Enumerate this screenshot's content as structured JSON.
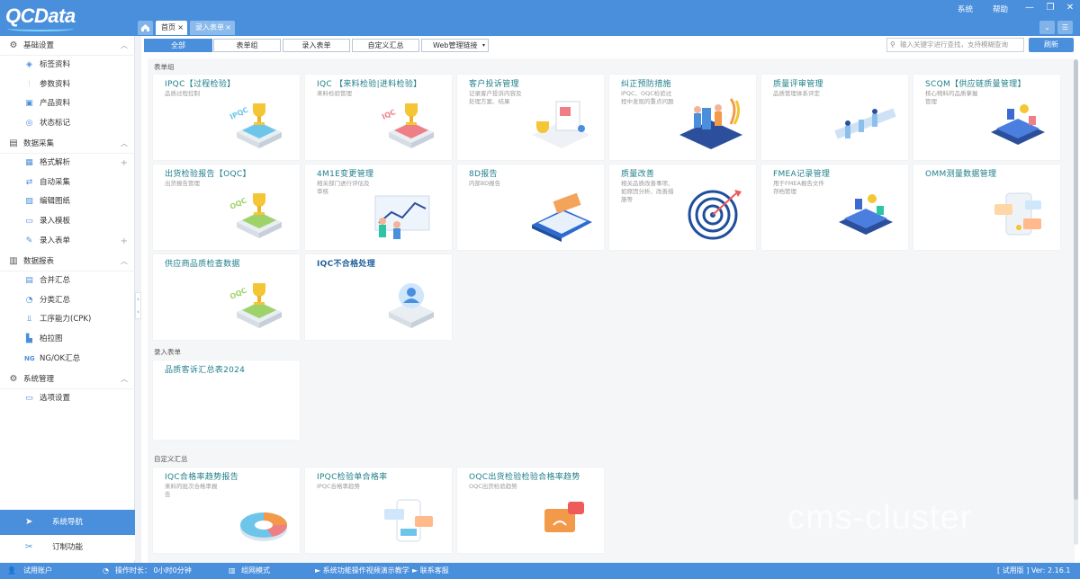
{
  "app": {
    "logo": "QCData"
  },
  "topmenu": {
    "system": "系统",
    "help": "帮助"
  },
  "window_controls": {
    "minimize": "—",
    "restore": "❐",
    "close": "✕"
  },
  "tabs": [
    {
      "label": "首页",
      "close": "×"
    },
    {
      "label": "录入表单",
      "close": "×"
    }
  ],
  "sidebar": {
    "groups": [
      {
        "label": "基础设置",
        "icon": "gear-icon",
        "items": [
          {
            "label": "标签资料",
            "icon": "tag-icon"
          },
          {
            "label": "参数资料",
            "icon": "sliders-icon"
          },
          {
            "label": "产品资料",
            "icon": "box-icon"
          },
          {
            "label": "状态标记",
            "icon": "status-icon"
          }
        ]
      },
      {
        "label": "数据采集",
        "icon": "collect-icon",
        "items": [
          {
            "label": "格式解析",
            "icon": "format-icon",
            "plus": "+"
          },
          {
            "label": "自动采集",
            "icon": "auto-icon"
          },
          {
            "label": "编辑图纸",
            "icon": "drawing-icon"
          },
          {
            "label": "录入模板",
            "icon": "template-icon"
          },
          {
            "label": "录入表单",
            "icon": "form-icon",
            "plus": "+"
          }
        ]
      },
      {
        "label": "数据报表",
        "icon": "report-icon",
        "items": [
          {
            "label": "合并汇总",
            "icon": "merge-icon"
          },
          {
            "label": "分类汇总",
            "icon": "pie-icon"
          },
          {
            "label": "工序能力(CPK)",
            "icon": "cpk-icon"
          },
          {
            "label": "柏拉图",
            "icon": "pareto-icon"
          },
          {
            "label": "NG/OK汇总",
            "icon": "ng-icon"
          }
        ]
      },
      {
        "label": "系统管理",
        "icon": "settings-icon",
        "items": [
          {
            "label": "选项设置",
            "icon": "option-icon"
          }
        ]
      }
    ],
    "bottom": [
      {
        "label": "系统导航"
      },
      {
        "label": "订制功能"
      }
    ]
  },
  "filter": {
    "buttons": [
      "全部",
      "表单组",
      "录入表单",
      "自定义汇总"
    ],
    "web_link": "Web管理链接",
    "search_placeholder": "输入关键字进行查找，支持模糊查询",
    "refresh": "刷新"
  },
  "sections": {
    "form_group": {
      "title": "表单组",
      "cards": [
        {
          "title": "IPQC【过程检验】",
          "desc": "品质过程控制"
        },
        {
          "title": "IQC 【来料检验|进料检验】",
          "desc": "来料检验管理"
        },
        {
          "title": "客户投诉管理",
          "desc": "记录客户投诉内容及处理方案、结果"
        },
        {
          "title": "纠正预防措施",
          "desc": "IPQC、OQC检验过程中发现的重点问题"
        },
        {
          "title": "质量评审管理",
          "desc": "品质管理体系评定"
        },
        {
          "title": "SCQM【供应链质量管理】",
          "desc": "核心物料的品质掌握管理"
        },
        {
          "title": "出货检验报告【OQC】",
          "desc": "出货报告管理"
        },
        {
          "title": "4M1E变更管理",
          "desc": "相关部门进行评估及审核"
        },
        {
          "title": "8D报告",
          "desc": "内部8D报告"
        },
        {
          "title": "质量改善",
          "desc": "相关品质改善事项、如原因分析、改善措施等"
        },
        {
          "title": "FMEA记录管理",
          "desc": "用于FMEA报告文件存档管理"
        },
        {
          "title": "OMM测量数据管理",
          "desc": ""
        },
        {
          "title": "供应商品质检查数据",
          "desc": ""
        },
        {
          "title": "IQC不合格处理",
          "desc": ""
        }
      ]
    },
    "entry_form": {
      "title": "录入表单",
      "cards": [
        {
          "title": "品质客诉汇总表2024",
          "desc": ""
        }
      ]
    },
    "custom_summary": {
      "title": "自定义汇总",
      "cards": [
        {
          "title": "IQC合格率趋势报告",
          "desc": "来料的批次合格率报告"
        },
        {
          "title": "IPQC检验单合格率",
          "desc": "IPQC合格率趋势"
        },
        {
          "title": "OQC出货检验检验合格率趋势",
          "desc": "OQC出货检验趋势"
        }
      ]
    }
  },
  "watermark": "cms-cluster",
  "statusbar": {
    "account": "试用账户",
    "duration": "操作时长： 0小时0分钟",
    "mode": "组网模式",
    "link1": "► 系统功能操作视频演示教学",
    "link2": "► 联系客服",
    "version": "[ 试用版 ] Ver: 2.16.1"
  }
}
